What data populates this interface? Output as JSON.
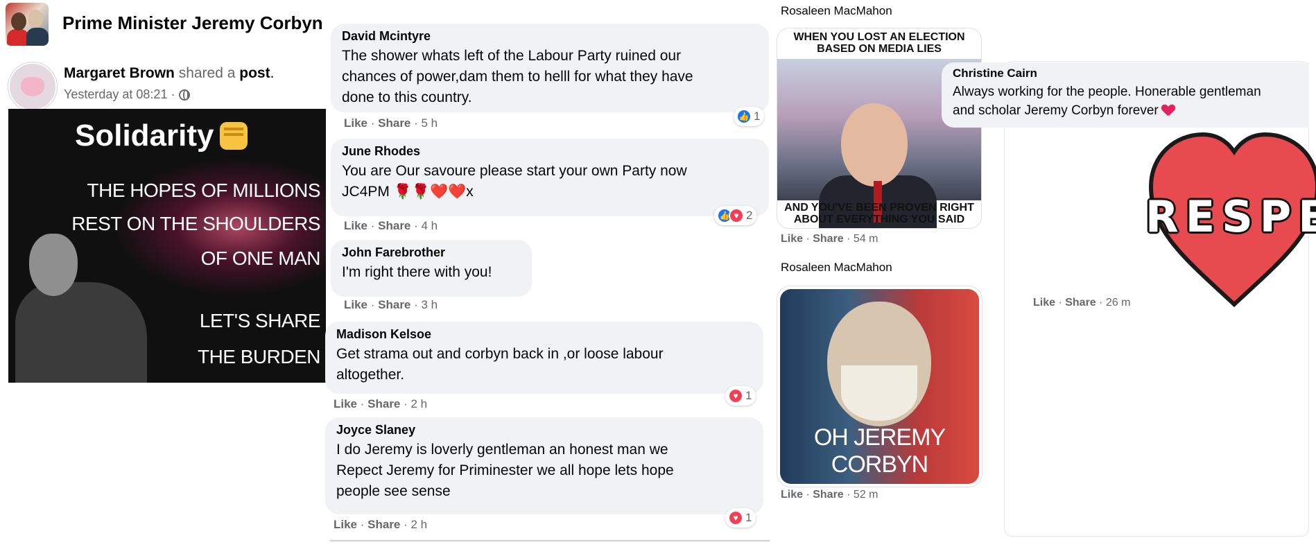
{
  "group": {
    "name": "Prime Minister Jeremy Corbyn"
  },
  "post": {
    "author": "Margaret Brown",
    "shared_text": "shared a",
    "post_word": "post",
    "period": ".",
    "time": "Yesterday at 08:21 ·",
    "image_text": {
      "title": "Solidarity",
      "lines": [
        "THE HOPES OF MILLIONS",
        "REST ON THE SHOULDERS",
        "OF ONE MAN",
        "LET'S SHARE",
        "THE BURDEN"
      ]
    }
  },
  "comments": [
    {
      "name": "David Mcintyre",
      "lines": [
        "The shower whats left of the Labour Party ruined our",
        "chances of power,dam them to helll for what they have",
        "done to this country."
      ],
      "like": "Like",
      "share": "Share",
      "time": "5 h",
      "reaction_count": "1"
    },
    {
      "name": "June Rhodes",
      "lines": [
        "You are Our savoure please start your own Party now",
        "JC4PM 🌹🌹❤️❤️x"
      ],
      "like": "Like",
      "share": "Share",
      "time": "4 h",
      "reaction_count": "2"
    },
    {
      "name": "John Farebrother",
      "lines": [
        "I'm right there with you!"
      ],
      "like": "Like",
      "share": "Share",
      "time": "3 h"
    },
    {
      "name": "Madison Kelsoe",
      "lines": [
        "Get strama out and corbyn back in ,or loose labour",
        "altogether."
      ],
      "like": "Like",
      "share": "Share",
      "time": "2 h",
      "reaction_count": "1"
    },
    {
      "name": "Joyce Slaney",
      "lines": [
        "I do Jeremy is loverly gentleman an honest man we",
        "Repect Jeremy for Priminester we all hope lets hope",
        "people see sense"
      ],
      "like": "Like",
      "share": "Share",
      "time": "2 h",
      "reaction_count": "1"
    }
  ],
  "right": {
    "reply1": {
      "name": "Rosaleen MacMahon",
      "meme_top": [
        "WHEN YOU LOST AN ELECTION",
        "BASED ON MEDIA LIES"
      ],
      "meme_bottom": [
        "AND YOU'VE BEEN PROVEN RIGHT",
        "ABOUT EVERYTHING YOU SAID"
      ],
      "like": "Like",
      "share": "Share",
      "time": "54 m"
    },
    "reply2": {
      "name": "Rosaleen MacMahon",
      "caption": "OH JEREMY CORBYN",
      "like": "Like",
      "share": "Share",
      "time": "52 m"
    },
    "reply3": {
      "name": "Christine Cairn",
      "lines": [
        "Always working for the people. Honerable gentleman",
        "and scholar Jeremy Corbyn forever"
      ],
      "sticker_text": "RESPEC",
      "like": "Like",
      "share": "Share",
      "time": "26 m"
    }
  },
  "colors": {
    "bubble": "#f0f2f5",
    "muted": "#65676b",
    "like_blue": "#1877f2",
    "love_red": "#f33e58"
  }
}
